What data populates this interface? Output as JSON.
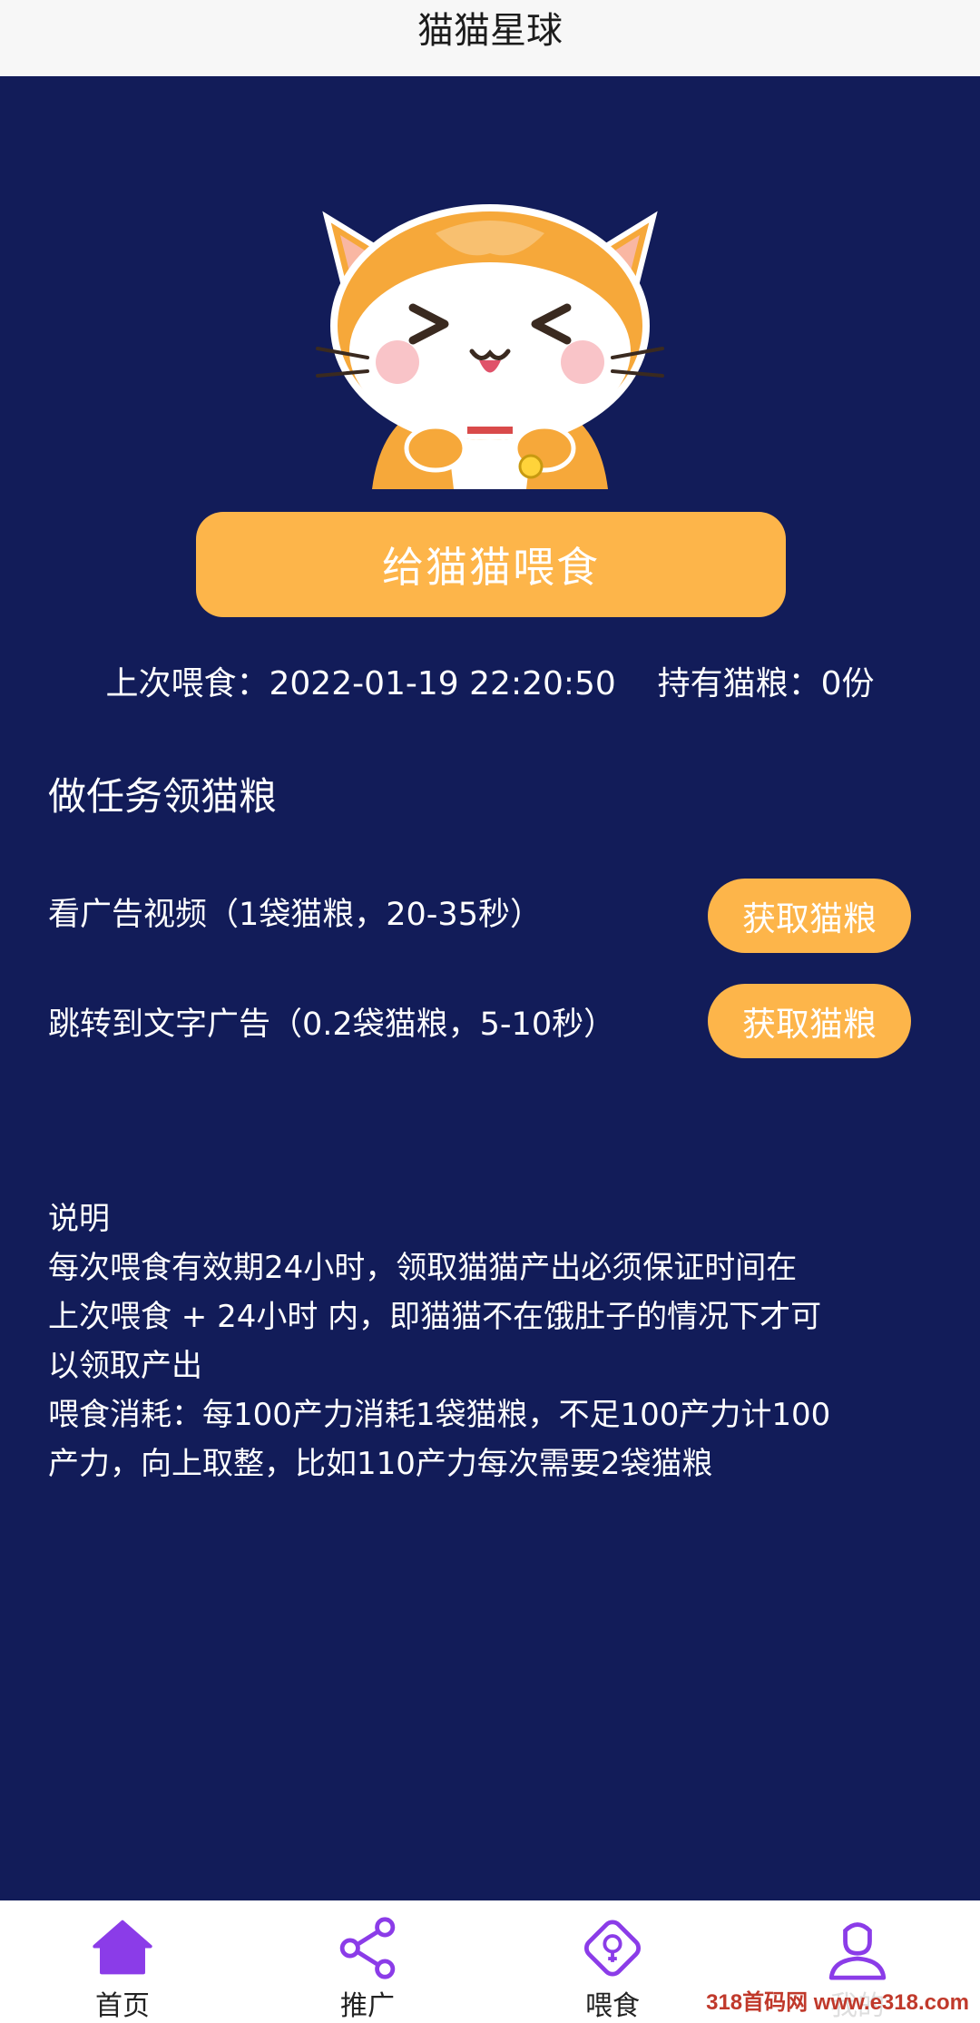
{
  "header": {
    "title": "猫猫星球"
  },
  "hero": {
    "feed_button_label": "给猫猫喂食"
  },
  "status": {
    "last_feed_label": "上次喂食：",
    "last_feed_time": "2022-01-19 22:20:50",
    "food_label": "持有猫粮：",
    "food_count": "0份"
  },
  "tasks": {
    "title": "做任务领猫粮",
    "items": [
      {
        "label": "看广告视频（1袋猫粮，20-35秒）",
        "button": "获取猫粮"
      },
      {
        "label": "跳转到文字广告（0.2袋猫粮，5-10秒）",
        "button": "获取猫粮"
      }
    ]
  },
  "notes": {
    "heading": "说明",
    "line1": "每次喂食有效期24小时，领取猫猫产出必须保证时间在",
    "line2": "上次喂食 + 24小时 内，即猫猫不在饿肚子的情况下才可",
    "line3": "以领取产出",
    "line4": "喂食消耗：每100产力消耗1袋猫粮，不足100产力计100",
    "line5": "产力，向上取整，比如110产力每次需要2袋猫粮"
  },
  "nav": {
    "items": [
      {
        "label": "首页",
        "icon": "home-icon"
      },
      {
        "label": "推广",
        "icon": "share-icon"
      },
      {
        "label": "喂食",
        "icon": "feed-icon"
      },
      {
        "label": "我的",
        "icon": "user-icon"
      }
    ]
  },
  "watermark": "318首码网 www.e318.com",
  "colors": {
    "background": "#121c59",
    "accent": "#fdb54a",
    "nav_active": "#8b3ce8"
  }
}
